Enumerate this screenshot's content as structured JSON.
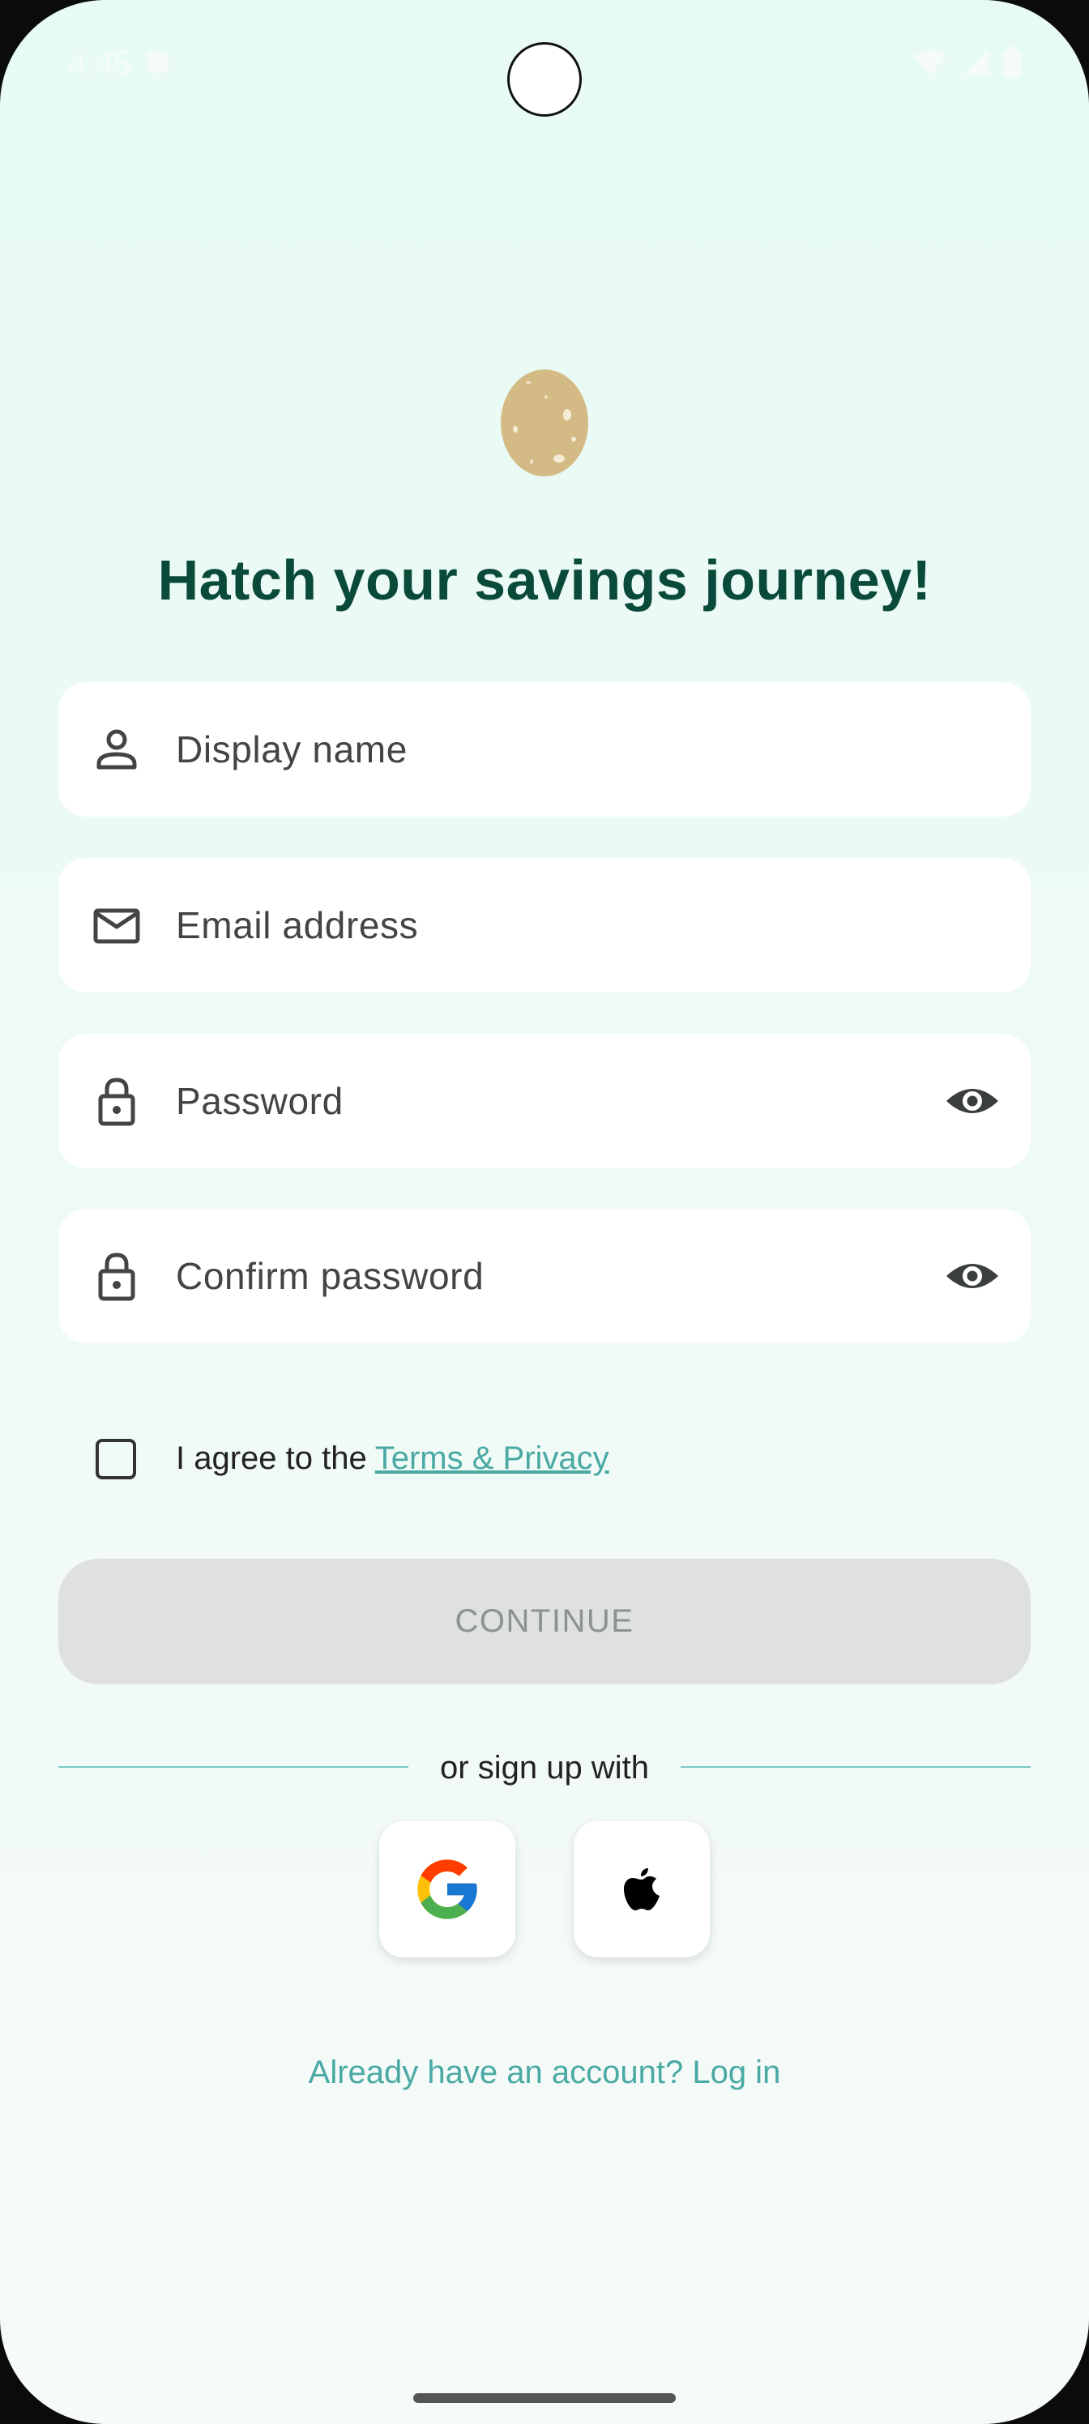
{
  "status_bar": {
    "time": "4:45"
  },
  "header": {
    "title": "Hatch your savings journey!"
  },
  "form": {
    "display_name": {
      "placeholder": "Display name",
      "icon": "person-icon"
    },
    "email": {
      "placeholder": "Email address",
      "icon": "mail-icon"
    },
    "password": {
      "placeholder": "Password",
      "icon": "lock-icon",
      "toggle_icon": "eye-icon"
    },
    "confirm_password": {
      "placeholder": "Confirm password",
      "icon": "lock-icon",
      "toggle_icon": "eye-icon"
    }
  },
  "agreement": {
    "checked": false,
    "prefix": "I agree to the",
    "link": "Terms & Privacy"
  },
  "continue": {
    "label": "CONTINUE",
    "enabled": false
  },
  "social": {
    "divider_label": "or sign up with",
    "providers": [
      "google",
      "apple"
    ]
  },
  "footer": {
    "login_link": "Already have an account? Log in"
  },
  "colors": {
    "title": "#0a4a3a",
    "accent": "#4aa9a3",
    "egg": "#d4bb85",
    "disabled_bg": "#dfe1e1"
  }
}
